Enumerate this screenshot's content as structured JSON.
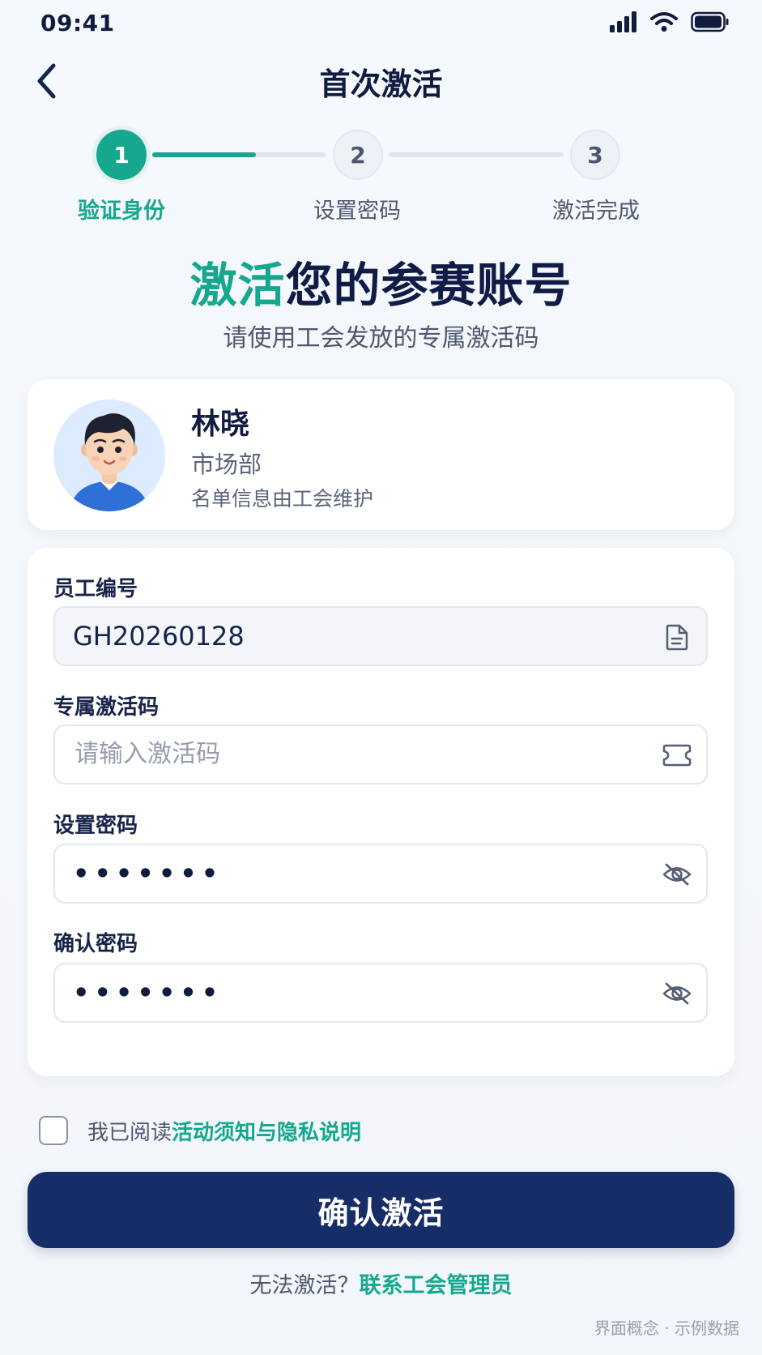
{
  "status_bar": {
    "time": "09:41"
  },
  "header": {
    "title": "首次激活"
  },
  "steps": [
    {
      "number": "1",
      "label": "验证身份",
      "state": "active"
    },
    {
      "number": "2",
      "label": "设置密码",
      "state": "inactive"
    },
    {
      "number": "3",
      "label": "激活完成",
      "state": "inactive"
    }
  ],
  "step_progress": 0.6,
  "hero": {
    "title_accent": "激活",
    "title_rest": "您的参赛账号",
    "subtitle": "请使用工会发放的专属激活码"
  },
  "profile": {
    "name": "林晓",
    "department": "市场部",
    "note": "名单信息由工会维护"
  },
  "form": {
    "employee_id_label": "员工编号",
    "employee_id_value": "GH20260128",
    "activation_code_label": "专属激活码",
    "activation_code_placeholder": "请输入激活码",
    "password_label": "设置密码",
    "password_value": "•••••••",
    "confirm_label": "确认密码",
    "confirm_value": "•••••••"
  },
  "agreement": {
    "prefix": "我已阅读",
    "link": "活动须知与隐私说明",
    "checked": false
  },
  "primary_button": {
    "label": "确认激活"
  },
  "help": {
    "prefix": "无法激活？",
    "link": "联系工会管理员"
  },
  "footer_note": "界面概念 · 示例数据",
  "colors": {
    "accent": "#16a78f",
    "primary": "#172d68",
    "text_dark": "#101c3f"
  },
  "icons": {
    "back": "chevron-left-icon",
    "signal": "signal-icon",
    "wifi": "wifi-icon",
    "battery": "battery-icon",
    "document": "document-icon",
    "ticket": "ticket-icon",
    "eye_off": "eye-off-icon"
  }
}
